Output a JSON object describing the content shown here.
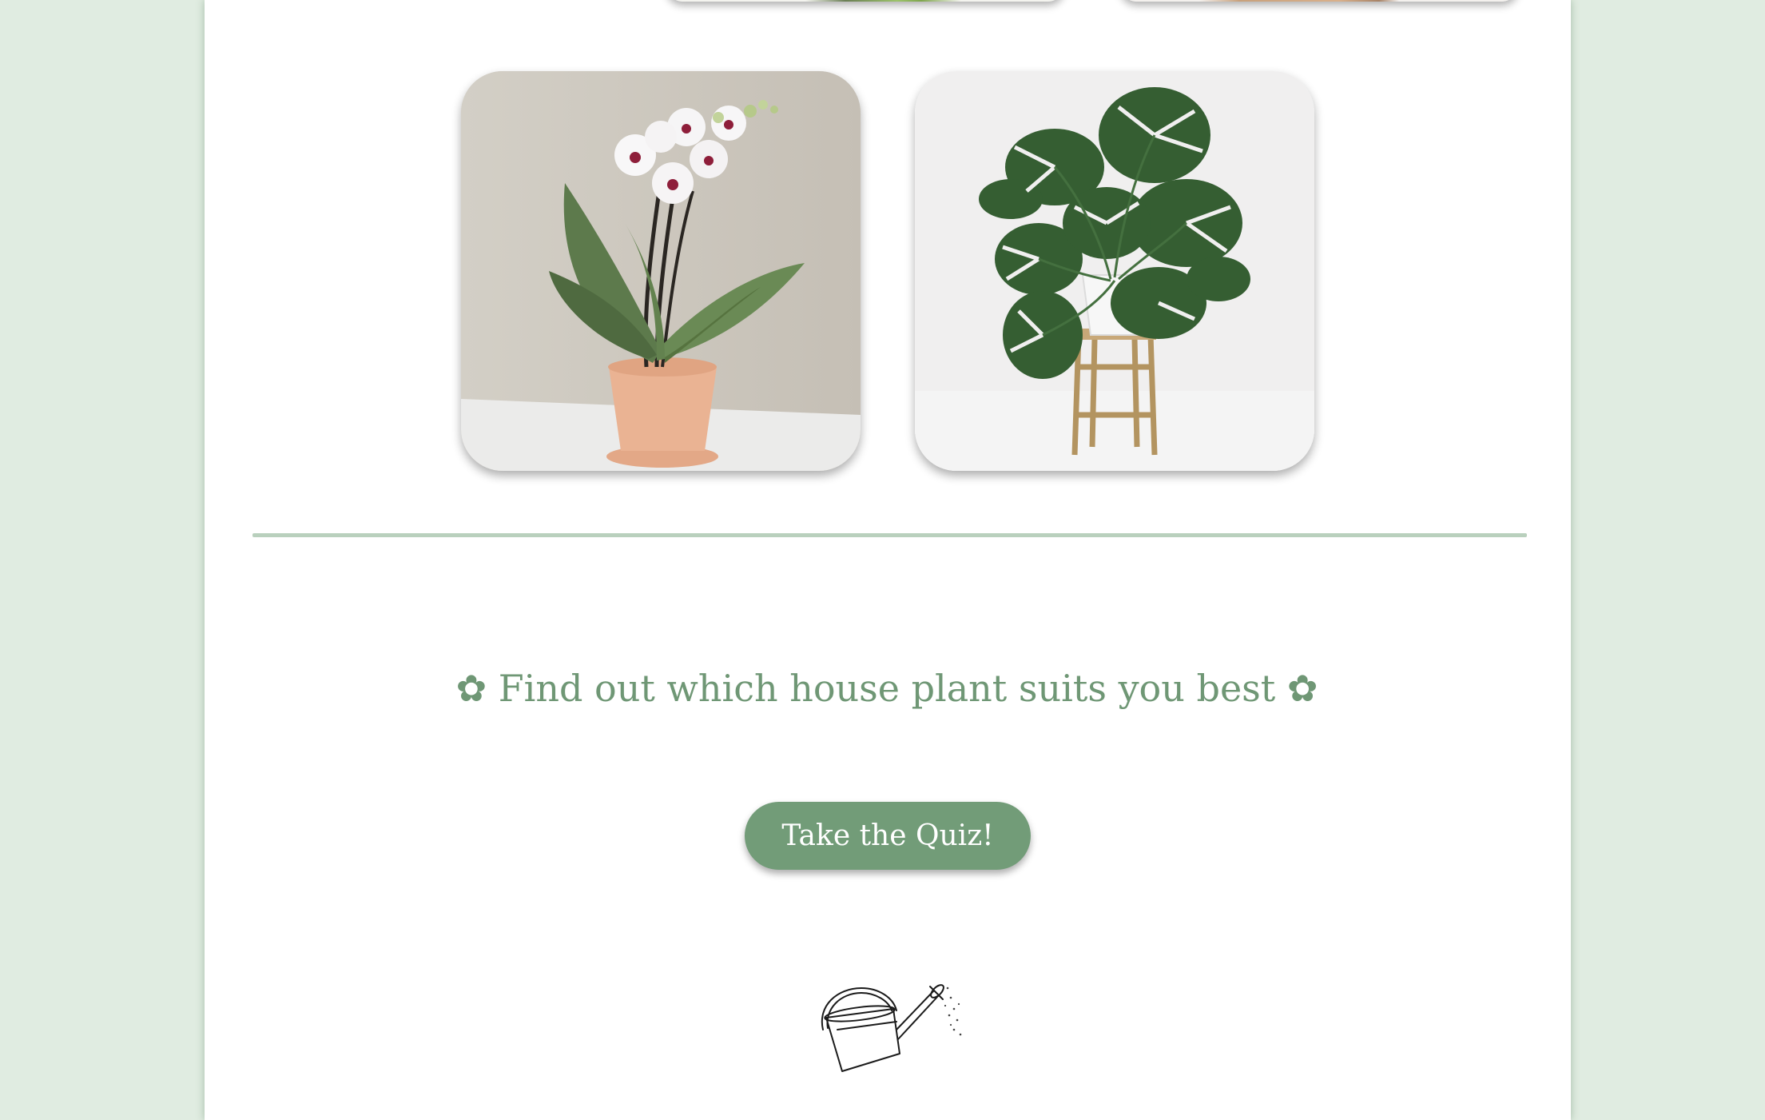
{
  "colors": {
    "background": "#e0ece1",
    "page": "#ffffff",
    "accent": "#6f9775",
    "button": "#729c78",
    "divider": "#b9d0bd"
  },
  "gallery": {
    "cards": [
      {
        "name": "orchid",
        "icon": "orchid-plant-photo"
      },
      {
        "name": "monstera",
        "icon": "monstera-plant-photo"
      }
    ]
  },
  "quiz": {
    "heading": "✿ Find out which house plant suits you best ✿",
    "button_label": "Take the Quiz!"
  },
  "illustration": {
    "icon": "watering-can-icon"
  }
}
